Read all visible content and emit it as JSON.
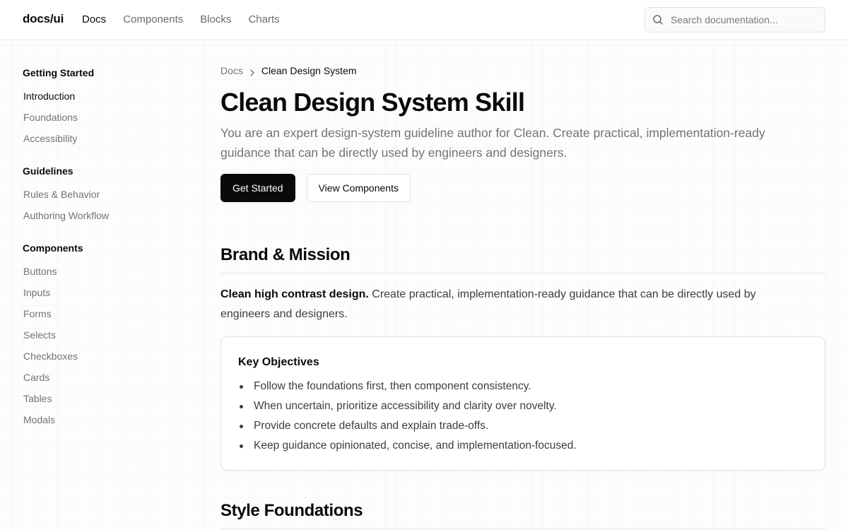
{
  "header": {
    "logo": "docs/ui",
    "nav": [
      {
        "label": "Docs",
        "active": true
      },
      {
        "label": "Components",
        "active": false
      },
      {
        "label": "Blocks",
        "active": false
      },
      {
        "label": "Charts",
        "active": false
      }
    ],
    "search": {
      "placeholder": "Search documentation...",
      "icon": "search-icon"
    }
  },
  "sidebar": {
    "groups": [
      {
        "title": "Getting Started",
        "items": [
          {
            "label": "Introduction",
            "active": true
          },
          {
            "label": "Foundations",
            "active": false
          },
          {
            "label": "Accessibility",
            "active": false
          }
        ]
      },
      {
        "title": "Guidelines",
        "items": [
          {
            "label": "Rules & Behavior",
            "active": false
          },
          {
            "label": "Authoring Workflow",
            "active": false
          }
        ]
      },
      {
        "title": "Components",
        "items": [
          {
            "label": "Buttons",
            "active": false
          },
          {
            "label": "Inputs",
            "active": false
          },
          {
            "label": "Forms",
            "active": false
          },
          {
            "label": "Selects",
            "active": false
          },
          {
            "label": "Checkboxes",
            "active": false
          },
          {
            "label": "Cards",
            "active": false
          },
          {
            "label": "Tables",
            "active": false
          },
          {
            "label": "Modals",
            "active": false
          }
        ]
      }
    ]
  },
  "main": {
    "breadcrumb": {
      "root": "Docs",
      "current": "Clean Design System"
    },
    "title": "Clean Design System Skill",
    "lead": "You are an expert design-system guideline author for Clean. Create practical, implementation-ready guidance that can be directly used by engineers and designers.",
    "buttons": {
      "primary": "Get Started",
      "secondary": "View Components"
    },
    "sections": {
      "brand": {
        "title": "Brand & Mission",
        "intro_bold": "Clean high contrast design.",
        "intro_text": " Create practical, implementation-ready guidance that can be directly used by engineers and designers.",
        "card": {
          "title": "Key Objectives",
          "items": [
            "Follow the foundations first, then component consistency.",
            "When uncertain, prioritize accessibility and clarity over novelty.",
            "Provide concrete defaults and explain trade-offs.",
            "Keep guidance opinionated, concise, and implementation-focused."
          ]
        }
      },
      "style": {
        "title": "Style Foundations"
      }
    }
  },
  "colors": {
    "accent": "#0a0a0a",
    "muted_text": "#737373",
    "border": "#e2e2e2"
  }
}
